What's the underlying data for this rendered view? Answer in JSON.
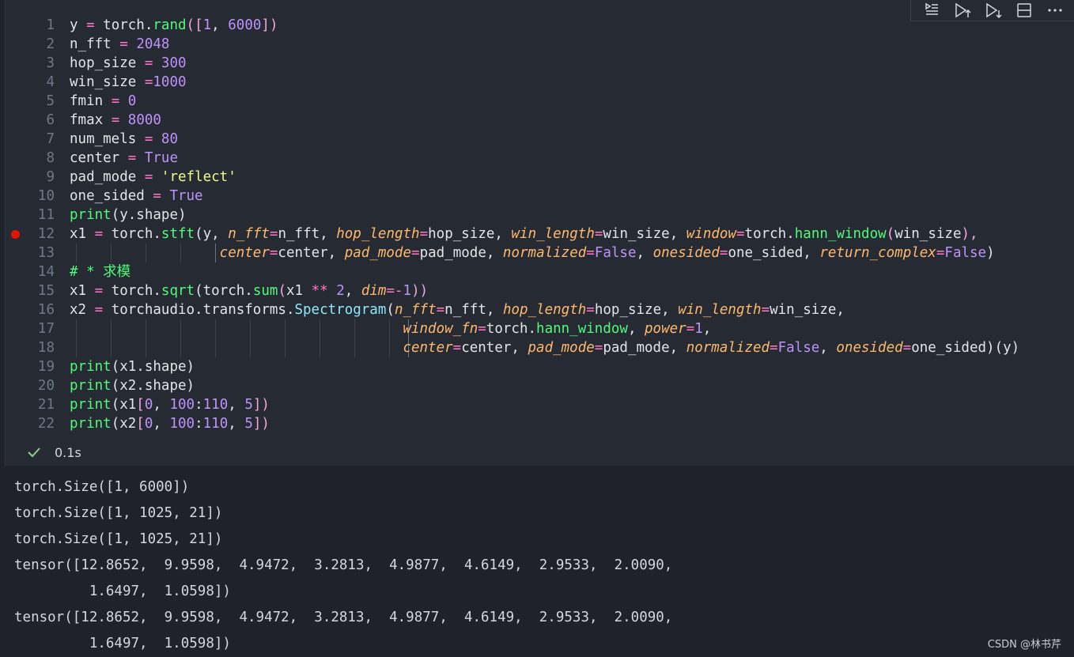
{
  "cell": {
    "lines": [
      {
        "n": "1",
        "parts": [
          [
            "y ",
            ""
          ],
          [
            "=",
            "op"
          ],
          [
            " torch.",
            ""
          ],
          [
            "rand",
            "fn"
          ],
          [
            "([",
            "br"
          ],
          [
            "1",
            "num"
          ],
          [
            ", ",
            ""
          ],
          [
            "6000",
            "num"
          ],
          [
            "])",
            "br"
          ]
        ]
      },
      {
        "n": "2",
        "parts": [
          [
            "n_fft ",
            ""
          ],
          [
            "=",
            "op"
          ],
          [
            " ",
            ""
          ],
          [
            "2048",
            "num"
          ]
        ]
      },
      {
        "n": "3",
        "parts": [
          [
            "hop_size ",
            ""
          ],
          [
            "=",
            "op"
          ],
          [
            " ",
            ""
          ],
          [
            "300",
            "num"
          ]
        ]
      },
      {
        "n": "4",
        "parts": [
          [
            "win_size ",
            ""
          ],
          [
            "=",
            "op"
          ],
          [
            "1000",
            "num"
          ]
        ]
      },
      {
        "n": "5",
        "parts": [
          [
            "fmin ",
            ""
          ],
          [
            "=",
            "op"
          ],
          [
            " ",
            ""
          ],
          [
            "0",
            "num"
          ]
        ]
      },
      {
        "n": "6",
        "parts": [
          [
            "fmax ",
            ""
          ],
          [
            "=",
            "op"
          ],
          [
            " ",
            ""
          ],
          [
            "8000",
            "num"
          ]
        ]
      },
      {
        "n": "7",
        "parts": [
          [
            "num_mels ",
            ""
          ],
          [
            "=",
            "op"
          ],
          [
            " ",
            ""
          ],
          [
            "80",
            "num"
          ]
        ]
      },
      {
        "n": "8",
        "parts": [
          [
            "center ",
            ""
          ],
          [
            "=",
            "op"
          ],
          [
            " ",
            ""
          ],
          [
            "True",
            "kw"
          ]
        ]
      },
      {
        "n": "9",
        "parts": [
          [
            "pad_mode ",
            ""
          ],
          [
            "=",
            "op"
          ],
          [
            " ",
            ""
          ],
          [
            "'reflect'",
            "str"
          ]
        ]
      },
      {
        "n": "10",
        "parts": [
          [
            "one_sided ",
            ""
          ],
          [
            "=",
            "op"
          ],
          [
            " ",
            ""
          ],
          [
            "True",
            "kw"
          ]
        ]
      },
      {
        "n": "11",
        "parts": [
          [
            "print",
            "fn"
          ],
          [
            "(y.shape)",
            ""
          ]
        ]
      },
      {
        "n": "12",
        "breakpoint": true,
        "parts": [
          [
            "x1 ",
            ""
          ],
          [
            "=",
            "op"
          ],
          [
            " torch.",
            ""
          ],
          [
            "stft",
            "fn"
          ],
          [
            "(y, ",
            ""
          ],
          [
            "n_fft",
            "kwarg"
          ],
          [
            "=",
            "op"
          ],
          [
            "n_fft, ",
            ""
          ],
          [
            "hop_length",
            "kwarg"
          ],
          [
            "=",
            "op"
          ],
          [
            "hop_size, ",
            ""
          ],
          [
            "win_length",
            "kwarg"
          ],
          [
            "=",
            "op"
          ],
          [
            "win_size, ",
            ""
          ],
          [
            "window",
            "kwarg"
          ],
          [
            "=",
            "op"
          ],
          [
            "torch.",
            ""
          ],
          [
            "hann_window",
            "fn"
          ],
          [
            "(",
            "br"
          ],
          [
            "win_size",
            ""
          ],
          [
            "),",
            "br"
          ]
        ]
      },
      {
        "n": "13",
        "indent": "                  ",
        "guides": [
          89,
          133,
          177,
          221,
          265
        ],
        "active": [
          265
        ],
        "parts": [
          [
            "center",
            "kwarg"
          ],
          [
            "=",
            "op"
          ],
          [
            "center, ",
            ""
          ],
          [
            "pad_mode",
            "kwarg"
          ],
          [
            "=",
            "op"
          ],
          [
            "pad_mode, ",
            ""
          ],
          [
            "normalized",
            "kwarg"
          ],
          [
            "=",
            "op"
          ],
          [
            "False",
            "kw"
          ],
          [
            ", ",
            ""
          ],
          [
            "onesided",
            "kwarg"
          ],
          [
            "=",
            "op"
          ],
          [
            "one_sided, ",
            ""
          ],
          [
            "return_complex",
            "kwarg"
          ],
          [
            "=",
            "op"
          ],
          [
            "False",
            "kw"
          ],
          [
            ")",
            ""
          ]
        ]
      },
      {
        "n": "14",
        "parts": [
          [
            "# * 求模",
            "cmt"
          ]
        ]
      },
      {
        "n": "15",
        "parts": [
          [
            "x1 ",
            ""
          ],
          [
            "=",
            "op"
          ],
          [
            " torch.",
            ""
          ],
          [
            "sqrt",
            "fn"
          ],
          [
            "(",
            ""
          ],
          [
            "torch.",
            ""
          ],
          [
            "sum",
            "fn"
          ],
          [
            "(",
            "br"
          ],
          [
            "x1 ",
            ""
          ],
          [
            "**",
            "op"
          ],
          [
            " ",
            ""
          ],
          [
            "2",
            "num"
          ],
          [
            ", ",
            ""
          ],
          [
            "dim",
            "kwarg"
          ],
          [
            "=-",
            "op"
          ],
          [
            "1",
            "num"
          ],
          [
            "))",
            "br"
          ]
        ]
      },
      {
        "n": "16",
        "parts": [
          [
            "x2 ",
            ""
          ],
          [
            "=",
            "op"
          ],
          [
            " torchaudio.transforms.",
            ""
          ],
          [
            "Spectrogram",
            "cls"
          ],
          [
            "(",
            ""
          ],
          [
            "n_fft",
            "kwarg"
          ],
          [
            "=",
            "op"
          ],
          [
            "n_fft, ",
            ""
          ],
          [
            "hop_length",
            "kwarg"
          ],
          [
            "=",
            "op"
          ],
          [
            "hop_size, ",
            ""
          ],
          [
            "win_length",
            "kwarg"
          ],
          [
            "=",
            "op"
          ],
          [
            "win_size,",
            ""
          ]
        ]
      },
      {
        "n": "17",
        "indent": "                                        ",
        "guides": [
          89,
          133,
          177,
          221,
          265,
          309,
          353,
          397,
          441,
          485,
          509
        ],
        "active": [
          509
        ],
        "parts": [
          [
            "window_fn",
            "kwarg"
          ],
          [
            "=",
            "op"
          ],
          [
            "torch.",
            ""
          ],
          [
            "hann_window",
            "fn"
          ],
          [
            ", ",
            ""
          ],
          [
            "power",
            "kwarg"
          ],
          [
            "=",
            "op"
          ],
          [
            "1",
            "num"
          ],
          [
            ",",
            ""
          ]
        ]
      },
      {
        "n": "18",
        "indent": "                                        ",
        "guides": [
          89,
          133,
          177,
          221,
          265,
          309,
          353,
          397,
          441,
          485,
          509
        ],
        "active": [
          509
        ],
        "parts": [
          [
            "center",
            "kwarg"
          ],
          [
            "=",
            "op"
          ],
          [
            "center, ",
            ""
          ],
          [
            "pad_mode",
            "kwarg"
          ],
          [
            "=",
            "op"
          ],
          [
            "pad_mode, ",
            ""
          ],
          [
            "normalized",
            "kwarg"
          ],
          [
            "=",
            "op"
          ],
          [
            "False",
            "kw"
          ],
          [
            ", ",
            ""
          ],
          [
            "onesided",
            "kwarg"
          ],
          [
            "=",
            "op"
          ],
          [
            "one_sided)(y)",
            ""
          ]
        ]
      },
      {
        "n": "19",
        "parts": [
          [
            "print",
            "fn"
          ],
          [
            "(x1.shape)",
            ""
          ]
        ]
      },
      {
        "n": "20",
        "parts": [
          [
            "print",
            "fn"
          ],
          [
            "(x2.shape)",
            ""
          ]
        ]
      },
      {
        "n": "21",
        "parts": [
          [
            "print",
            "fn"
          ],
          [
            "(x1",
            ""
          ],
          [
            "[",
            "br"
          ],
          [
            "0",
            "num"
          ],
          [
            ", ",
            ""
          ],
          [
            "100",
            "num"
          ],
          [
            ":",
            ""
          ],
          [
            "110",
            "num"
          ],
          [
            ", ",
            ""
          ],
          [
            "5",
            "num"
          ],
          [
            "])",
            "br"
          ]
        ]
      },
      {
        "n": "22",
        "parts": [
          [
            "print",
            "fn"
          ],
          [
            "(x2",
            ""
          ],
          [
            "[",
            "br"
          ],
          [
            "0",
            "num"
          ],
          [
            ", ",
            ""
          ],
          [
            "100",
            "num"
          ],
          [
            ":",
            ""
          ],
          [
            "110",
            "num"
          ],
          [
            ", ",
            ""
          ],
          [
            "5",
            "num"
          ],
          [
            "])",
            "br"
          ]
        ]
      }
    ],
    "toolbar": {
      "icons": [
        "execute-above-icon",
        "run-above-icon",
        "run-below-icon",
        "split-cell-icon",
        "more-icon"
      ]
    },
    "status": {
      "icon": "check-icon",
      "time": "0.1s"
    }
  },
  "output": {
    "lines": [
      "torch.Size([1, 6000])",
      "torch.Size([1, 1025, 21])",
      "torch.Size([1, 1025, 21])",
      "tensor([12.8652,  9.9598,  4.9472,  3.2813,  4.9877,  4.6149,  2.9533,  2.0090,",
      "         1.6497,  1.0598])",
      "tensor([12.8652,  9.9598,  4.9472,  3.2813,  4.9877,  4.6149,  2.9533,  2.0090,",
      "         1.6497,  1.0598])"
    ]
  },
  "watermark": "CSDN @林书芹"
}
